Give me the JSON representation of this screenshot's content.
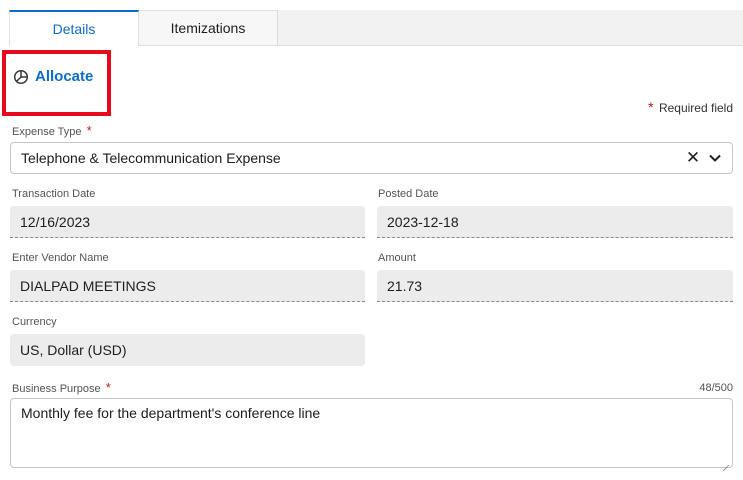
{
  "tabs": [
    {
      "label": "Details",
      "active": true
    },
    {
      "label": "Itemizations",
      "active": false
    }
  ],
  "allocate": {
    "label": "Allocate",
    "icon": "pie-chart-icon"
  },
  "required_note": {
    "star": "*",
    "text": "Required field"
  },
  "expense_type": {
    "label": "Expense Type",
    "required_star": "*",
    "value": "Telephone & Telecommunication Expense",
    "clear_icon": "✕",
    "chevron_icon": "chevron-down-icon"
  },
  "transaction_date": {
    "label": "Transaction Date",
    "value": "12/16/2023"
  },
  "posted_date": {
    "label": "Posted Date",
    "value": "2023-12-18"
  },
  "vendor_name": {
    "label": "Enter Vendor Name",
    "value": "DIALPAD MEETINGS"
  },
  "amount": {
    "label": "Amount",
    "value": "21.73"
  },
  "currency": {
    "label": "Currency",
    "value": "US, Dollar (USD)"
  },
  "business_purpose": {
    "label": "Business Purpose",
    "required_star": "*",
    "value": "Monthly fee for the department's conference line",
    "char_count": "48/500"
  },
  "colors": {
    "accent": "#0a6ed1",
    "required": "#c4161c",
    "highlight": "#e8091c"
  }
}
